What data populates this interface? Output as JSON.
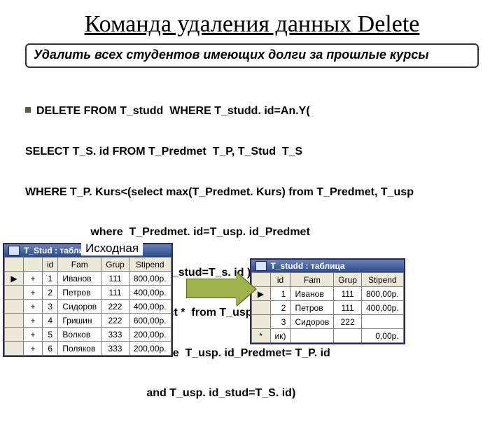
{
  "title": "Команда удаления данных Delete",
  "subtitle": "Удалить всех студентов имеющих долги за прошлые курсы",
  "sql": {
    "l1": "DELETE FROM T_studd  WHERE T_studd. id=An.Y(",
    "l2": "SELECT T_S. id FROM T_Predmet  T_P, T_Stud  T_S",
    "l3": "WHERE T_P. Kurs<(select max(T_Predmet. Kurs) from T_Predmet, T_usp",
    "l4": "                     where  T_Predmet. id=T_usp. id_Predmet",
    "l5": "                        and T_usp. id_stud=T_s. id )",
    "l6": "            and not Exists (select *  from T_usp",
    "l7": "                                       where  T_usp. id_Predmet= T_P. id",
    "l8": "                                       and T_usp. id_stud=T_S. id)"
  },
  "left_label": "Исходная",
  "left_table": {
    "title": "T_Stud : таблица",
    "headers": [
      "",
      "",
      "id",
      "Fam",
      "Grup",
      "Stipend"
    ],
    "rows": [
      {
        "sel": "▶",
        "ex": "+",
        "id": "1",
        "fam": "Иванов",
        "grup": "111",
        "stip": "800,00р."
      },
      {
        "sel": "",
        "ex": "+",
        "id": "2",
        "fam": "Петров",
        "grup": "111",
        "stip": "400,00р."
      },
      {
        "sel": "",
        "ex": "+",
        "id": "3",
        "fam": "Сидоров",
        "grup": "222",
        "stip": "400,00р."
      },
      {
        "sel": "",
        "ex": "+",
        "id": "4",
        "fam": "Гришин",
        "grup": "222",
        "stip": "600,00р."
      },
      {
        "sel": "",
        "ex": "+",
        "id": "5",
        "fam": "Волков",
        "grup": "333",
        "stip": "200,00р."
      },
      {
        "sel": "",
        "ex": "+",
        "id": "6",
        "fam": "Поляков",
        "grup": "333",
        "stip": "200,00р."
      }
    ]
  },
  "right_table": {
    "title": "T_studd : таблица",
    "headers": [
      "",
      "id",
      "Fam",
      "Grup",
      "Stipend"
    ],
    "rows": [
      {
        "sel": "▶",
        "id": "1",
        "fam": "Иванов",
        "grup": "111",
        "stip": "800,00р."
      },
      {
        "sel": "",
        "id": "2",
        "fam": "Петров",
        "grup": "111",
        "stip": "400,00р."
      },
      {
        "sel": "",
        "id": "3",
        "fam": "Сидоров",
        "grup": "222",
        "stip": ""
      },
      {
        "sel": "*",
        "id": "ик)",
        "fam": "",
        "grup": "",
        "stip": "0,00р."
      }
    ]
  }
}
